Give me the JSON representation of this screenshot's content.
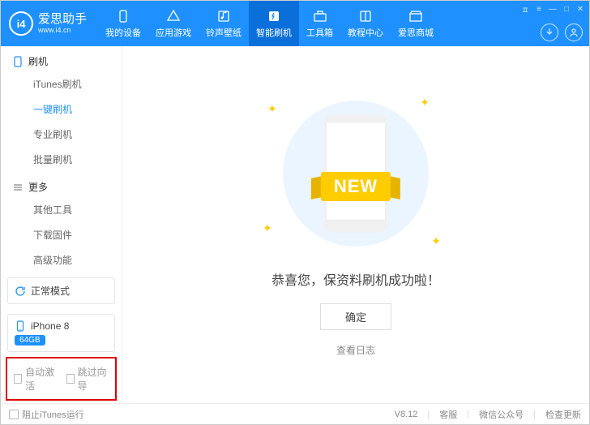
{
  "brand": {
    "badge": "i4",
    "name": "爱思助手",
    "url": "www.i4.cn"
  },
  "nav": [
    {
      "label": "我的设备",
      "icon": "phone-icon"
    },
    {
      "label": "应用游戏",
      "icon": "apps-icon"
    },
    {
      "label": "铃声壁纸",
      "icon": "music-icon"
    },
    {
      "label": "智能刷机",
      "icon": "flash-icon",
      "active": true
    },
    {
      "label": "工具箱",
      "icon": "toolbox-icon"
    },
    {
      "label": "教程中心",
      "icon": "book-icon"
    },
    {
      "label": "爱思商城",
      "icon": "shop-icon"
    }
  ],
  "sidebar": {
    "section1": {
      "title": "刷机",
      "items": [
        "iTunes刷机",
        "一键刷机",
        "专业刷机",
        "批量刷机"
      ],
      "activeIndex": 1
    },
    "section2": {
      "title": "更多",
      "items": [
        "其他工具",
        "下载固件",
        "高级功能"
      ]
    },
    "mode": "正常模式",
    "device": {
      "name": "iPhone 8",
      "badge": "64GB"
    },
    "checkboxes": {
      "autoActivate": "自动激活",
      "skipWizard": "跳过向导"
    }
  },
  "main": {
    "ribbon": "NEW",
    "successText": "恭喜您，保资料刷机成功啦！",
    "okButton": "确定",
    "viewLog": "查看日志"
  },
  "statusbar": {
    "blockItunes": "阻止iTunes运行",
    "version": "V8.12",
    "support": "客服",
    "wechat": "微信公众号",
    "update": "检查更新"
  }
}
